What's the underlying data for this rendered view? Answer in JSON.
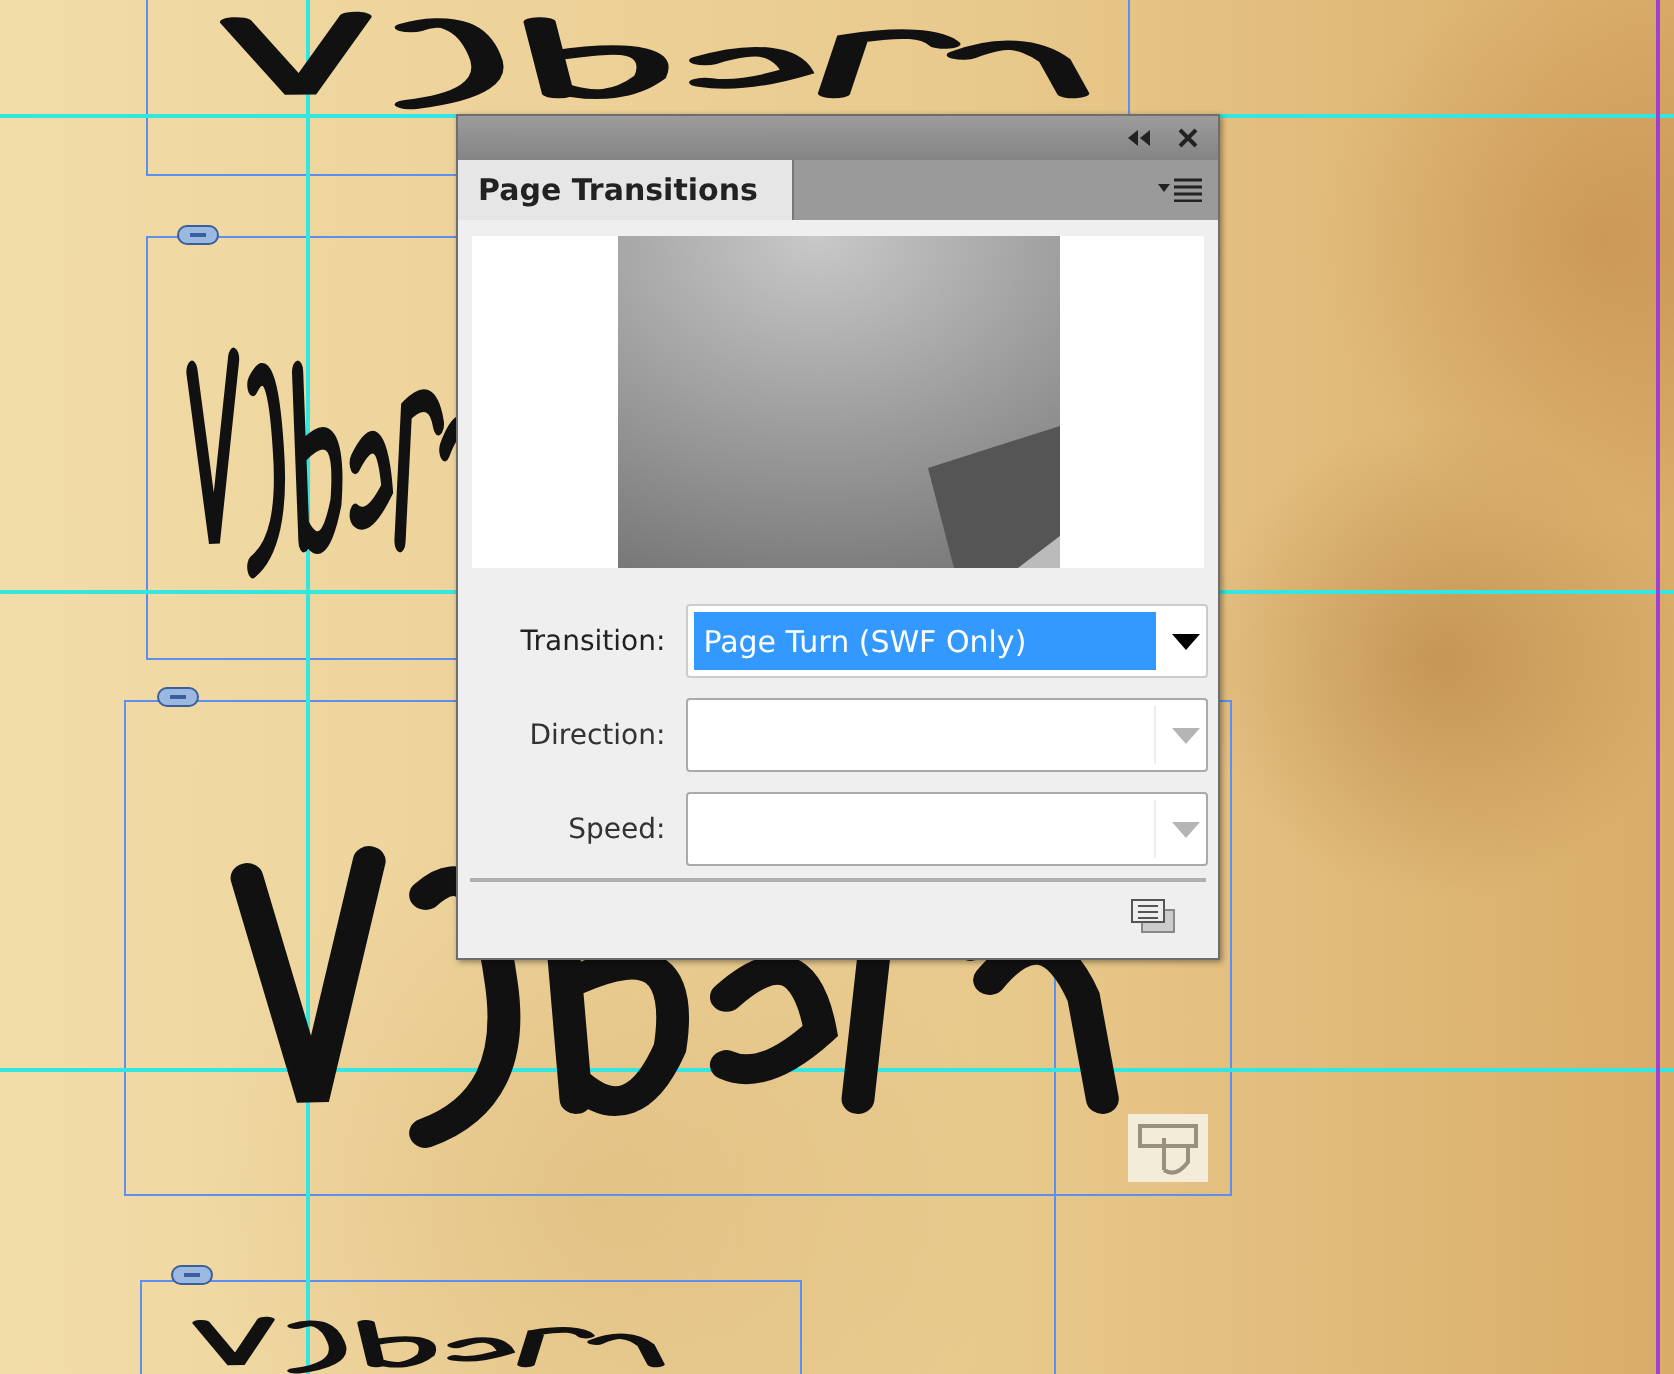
{
  "panel": {
    "title": "Page Transitions",
    "fields": [
      {
        "label": "Transition:",
        "value": "Page Turn (SWF Only)",
        "disabled": false
      },
      {
        "label": "Direction:",
        "disabled": true
      },
      {
        "label": "Speed:",
        "disabled": true
      }
    ]
  }
}
